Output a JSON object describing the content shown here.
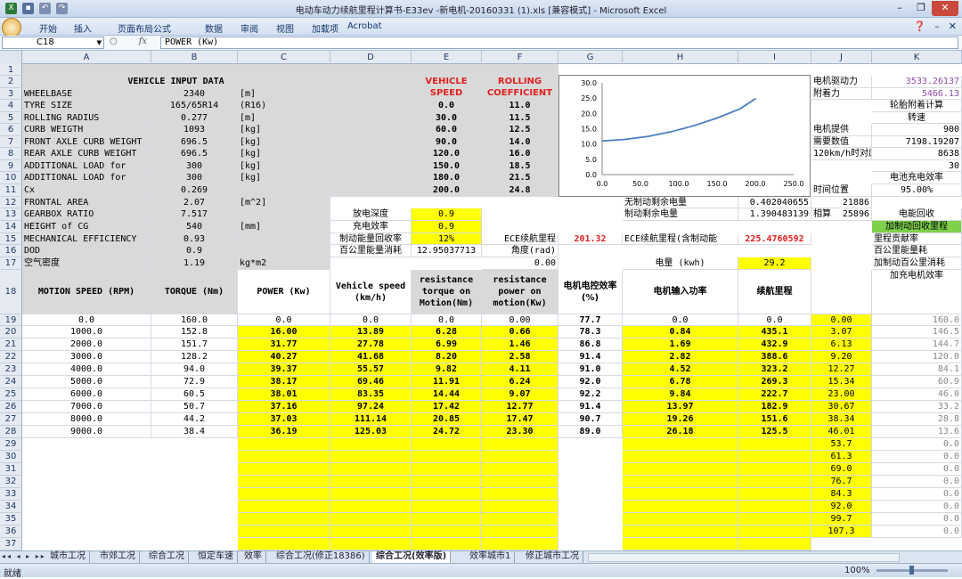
{
  "window": {
    "title": "电动车动力续航里程计算书-E33ev -新电机-20160331 (1).xls  [兼容模式] - Microsoft Excel"
  },
  "ribbon": {
    "tabs": [
      "开始",
      "插入",
      "页面布局",
      "公式",
      "数据",
      "审阅",
      "视图",
      "加载项",
      "Acrobat"
    ]
  },
  "formula": {
    "namebox": "C18",
    "fx": "fx",
    "content": "POWER (Kw)"
  },
  "columns": [
    "A",
    "B",
    "C",
    "D",
    "E",
    "F",
    "G",
    "H",
    "I",
    "J",
    "K"
  ],
  "rows": [
    "1",
    "2",
    "3",
    "4",
    "5",
    "6",
    "7",
    "8",
    "9",
    "10",
    "11",
    "12",
    "13",
    "14",
    "15",
    "16",
    "17",
    "18",
    "19",
    "20",
    "21",
    "22",
    "23",
    "24",
    "25",
    "26",
    "27",
    "28",
    "29",
    "30",
    "31",
    "32",
    "33",
    "34",
    "35",
    "36",
    "37"
  ],
  "vehicle": {
    "title": "VEHICLE INPUT DATA",
    "params": [
      {
        "label": "WHEELBASE",
        "value": "2340",
        "unit": "[m]"
      },
      {
        "label": "TYRE SIZE",
        "value": "165/65R14",
        "unit": "(R16)"
      },
      {
        "label": "ROLLING RADIUS",
        "value": "0.277",
        "unit": "[m]"
      },
      {
        "label": "CURB WEIGTH",
        "value": "1093",
        "unit": "[kg]"
      },
      {
        "label": "FRONT AXLE CURB WEIGHT",
        "value": "696.5",
        "unit": "[kg]"
      },
      {
        "label": "REAR AXLE CURB WEIGHT",
        "value": "696.5",
        "unit": "[kg]"
      },
      {
        "label": "ADDITIONAL LOAD for",
        "value": "300",
        "unit": "[kg]"
      },
      {
        "label": "ADDITIONAL LOAD for",
        "value": "300",
        "unit": "[kg]"
      },
      {
        "label": "Cx",
        "value": "0.269",
        "unit": ""
      },
      {
        "label": "FRONTAL AREA",
        "value": "2.07",
        "unit": "[m^2]"
      },
      {
        "label": "GEARBOX RATIO",
        "value": "7.517",
        "unit": ""
      },
      {
        "label": "HEIGHT of CG",
        "value": "540",
        "unit": "[mm]"
      },
      {
        "label": "MECHANICAL EFFICIENCY",
        "value": "0.93",
        "unit": ""
      },
      {
        "label": "DOD",
        "value": "0.9",
        "unit": ""
      },
      {
        "label": "空气密度",
        "value": "1.19",
        "unit": "kg*m2"
      }
    ]
  },
  "rolling": {
    "h1": "VEHICLE SPEED",
    "h2": "ROLLING COEFFICIENT",
    "rows": [
      [
        "0.0",
        "11.0"
      ],
      [
        "30.0",
        "11.5"
      ],
      [
        "60.0",
        "12.5"
      ],
      [
        "90.0",
        "14.0"
      ],
      [
        "120.0",
        "16.0"
      ],
      [
        "150.0",
        "18.5"
      ],
      [
        "180.0",
        "21.5"
      ],
      [
        "200.0",
        "24.8"
      ]
    ]
  },
  "mid": {
    "discharge_depth_label": "放电深度",
    "discharge_depth": "0.9",
    "charge_eff_label": "充电效率",
    "charge_eff": "0.9",
    "regen_label": "制动能量回收率",
    "regen": "12%",
    "per100_label": "百公里能量消耗",
    "per100": "12.95037713",
    "angle_label": "角度(rad)",
    "angle": "0.00",
    "ece_label": "ECE续航里程",
    "ece": "201.32",
    "ece_regen_label": "ECE续航里程(含制动能",
    "ece_regen": "225.4760592",
    "no_regen_label": "无制动剩余电量",
    "no_regen": "0.402040655",
    "no_regen_j": "21886",
    "regen_rem_label": "制动剩余电量",
    "regen_rem": "1.390483139",
    "regen_rem_j": "25896",
    "battery_label": "电量 (kwh)",
    "battery": "29.2"
  },
  "right": {
    "drive_force_label": "电机驱动力",
    "drive_force": "3533.26137",
    "adhesion_label": "附着力",
    "adhesion": "5466.13",
    "tire_calc": "轮胎附着计算",
    "speed_label": "转速",
    "motor_provide_label": "电机提供",
    "motor_provide": "900",
    "required_label": "需要数值",
    "required": "7198.19207",
    "kmh_label": "120km/h时对应",
    "kmh": "8638",
    "k10": "30",
    "batt_eff_label": "电池充电效率",
    "batt_eff": "95.00%",
    "time_label": "时间位置",
    "calc_label": "相算",
    "regen_title": "电能回收",
    "regen_range": "加制动回收里程",
    "range_contrib": "里程贡献率",
    "per100_k": "百公里能量耗",
    "regen_per100": "加制动百公里消耗",
    "charge_motor_eff": "加充电机效率"
  },
  "chart_data": {
    "type": "line",
    "x": [
      0,
      30,
      60,
      90,
      120,
      150,
      180,
      200
    ],
    "series": [
      {
        "values": [
          11.0,
          11.5,
          12.5,
          14.0,
          16.0,
          18.5,
          21.5,
          24.8
        ]
      }
    ],
    "xlim": [
      0,
      250
    ],
    "ylim": [
      0,
      30
    ],
    "xticks": [
      "0.0",
      "50.0",
      "100.0",
      "150.0",
      "200.0",
      "250.0"
    ],
    "yticks": [
      "0.0",
      "5.0",
      "10.0",
      "15.0",
      "20.0",
      "25.0",
      "30.0"
    ],
    "grid": false,
    "color": "#4a7fc1"
  },
  "motion": {
    "headers": [
      "MOTION SPEED (RPM)",
      "TORQUE (Nm)",
      "POWER (Kw)",
      "Vehicle speed (km/h)",
      "resistance torque on Motion(Nm)",
      "resistance power on motion(Kw)",
      "电机电控效率(%)",
      "电机输入功率",
      "续航里程"
    ],
    "rows": [
      [
        "0.0",
        "160.0",
        "0.0",
        "0.0",
        "0.0",
        "0.00",
        "77.7",
        "0.0",
        "0.0"
      ],
      [
        "1000.0",
        "152.8",
        "16.00",
        "13.89",
        "6.28",
        "0.66",
        "78.3",
        "0.84",
        "435.1"
      ],
      [
        "2000.0",
        "151.7",
        "31.77",
        "27.78",
        "6.99",
        "1.46",
        "86.8",
        "1.69",
        "432.9"
      ],
      [
        "3000.0",
        "128.2",
        "40.27",
        "41.68",
        "8.20",
        "2.58",
        "91.4",
        "2.82",
        "388.6"
      ],
      [
        "4000.0",
        "94.0",
        "39.37",
        "55.57",
        "9.82",
        "4.11",
        "91.0",
        "4.52",
        "323.2"
      ],
      [
        "5000.0",
        "72.9",
        "38.17",
        "69.46",
        "11.91",
        "6.24",
        "92.0",
        "6.78",
        "269.3"
      ],
      [
        "6000.0",
        "60.5",
        "38.01",
        "83.35",
        "14.44",
        "9.07",
        "92.2",
        "9.84",
        "222.7"
      ],
      [
        "7000.0",
        "50.7",
        "37.16",
        "97.24",
        "17.42",
        "12.77",
        "91.4",
        "13.97",
        "182.9"
      ],
      [
        "8000.0",
        "44.2",
        "37.03",
        "111.14",
        "20.85",
        "17.47",
        "90.7",
        "19.26",
        "151.6"
      ],
      [
        "9000.0",
        "38.4",
        "36.19",
        "125.03",
        "24.72",
        "23.30",
        "89.0",
        "26.18",
        "125.5"
      ]
    ],
    "j": [
      "0.00",
      "3.07",
      "6.13",
      "9.20",
      "12.27",
      "15.34",
      "23.00",
      "30.67",
      "38.34",
      "46.01",
      "53.7",
      "61.3",
      "69.0",
      "76.7",
      "84.3",
      "92.0",
      "99.7",
      "107.3"
    ],
    "k": [
      "160.0",
      "146.5",
      "144.7",
      "120.0",
      "84.1",
      "60.9",
      "46.0",
      "33.2",
      "28.8",
      "13.6",
      "0.0",
      "0.0",
      "0.0",
      "0.0",
      "0.0",
      "0.0",
      "0.0",
      "0.0"
    ]
  },
  "tabs": [
    "城市工况",
    "市郊工况",
    "综合工况",
    "恒定车速",
    "效率",
    "综合工况(修正18386)",
    "综合工况(效率版)",
    "效率城市1",
    "修正城市工况"
  ],
  "status": {
    "ready": "就绪",
    "zoom": "100%"
  }
}
